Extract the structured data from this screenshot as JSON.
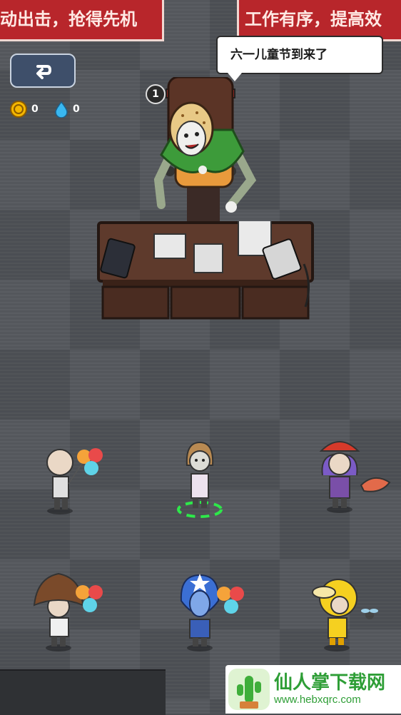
{
  "banners": {
    "left": "动出击，抢得先机",
    "right": "工作有序，提高效"
  },
  "counters": {
    "coins": "0",
    "water": "0"
  },
  "boss": {
    "speech": "六一儿童节到来了",
    "level": "1",
    "hp_fraction": 1.0
  },
  "watermark": {
    "main": "仙人掌下载网",
    "sub": "www.hebxqrc.com"
  },
  "colors": {
    "banner_red": "#b8262b",
    "hp_red": "#e53935",
    "selection_green": "#2ee84a",
    "watermark_green": "#2e9e36"
  },
  "icons": [
    "back-arrow-icon",
    "coin-icon",
    "water-drop-icon",
    "cactus-logo-icon"
  ]
}
